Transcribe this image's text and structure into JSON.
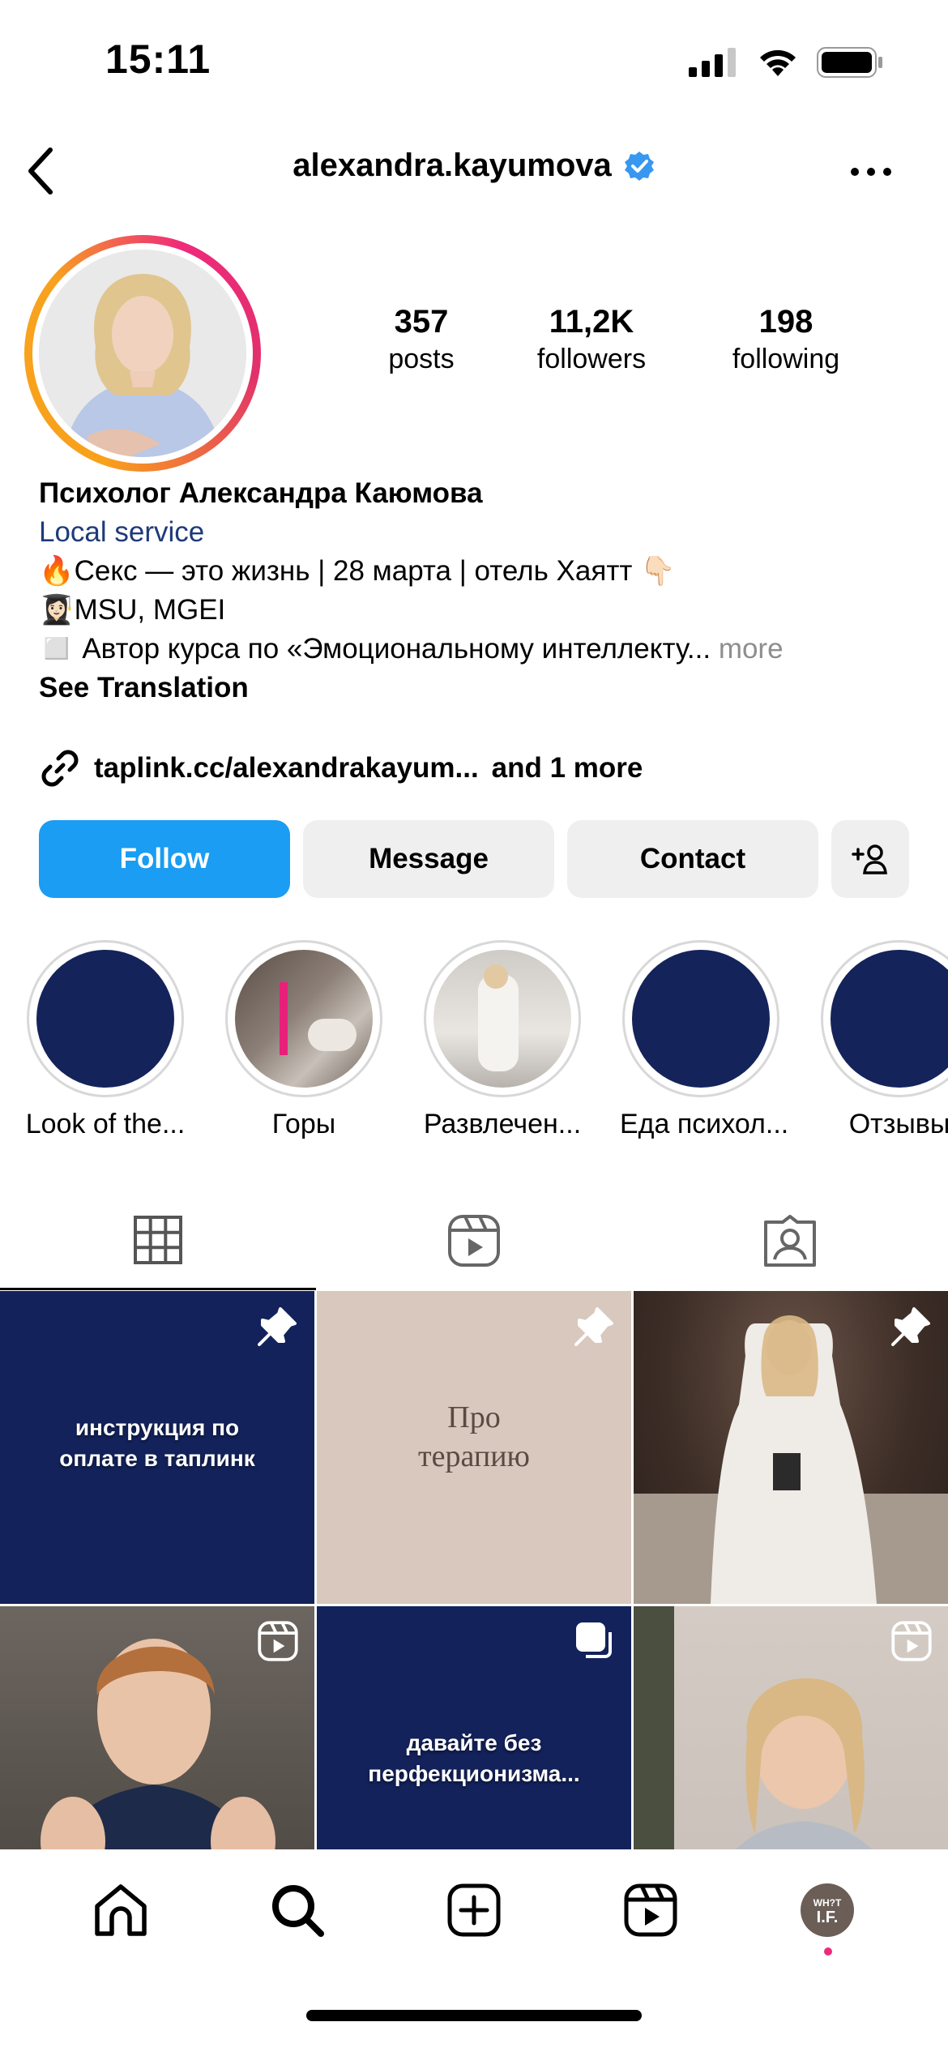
{
  "status_bar": {
    "time": "15:11"
  },
  "header": {
    "username": "alexandra.kayumova"
  },
  "stats": [
    {
      "value": "357",
      "label": "posts"
    },
    {
      "value": "11,2K",
      "label": "followers"
    },
    {
      "value": "198",
      "label": "following"
    }
  ],
  "bio": {
    "name": "Психолог Александра Каюмова",
    "category": "Local service",
    "line1_emoji": "🔥",
    "line1_text": "Секс — это жизнь | 28 марта | отель Хаятт",
    "line1_end_emoji": "👇🏻",
    "line2_emoji": "👩🏻‍🎓",
    "line2_text": "MSU, MGEI",
    "line3_emoji": "◻️",
    "line3_text": "Автор курса по «Эмоциональному интеллекту...",
    "more": "more",
    "see_translation": "See Translation"
  },
  "link": {
    "url": "taplink.cc/alexandrakayum...",
    "extra": "and 1 more"
  },
  "buttons": {
    "follow": "Follow",
    "message": "Message",
    "contact": "Contact"
  },
  "highlights": [
    {
      "label": "Look of the..."
    },
    {
      "label": "Горы"
    },
    {
      "label": "Развлечен..."
    },
    {
      "label": "Еда психол..."
    },
    {
      "label": "Отзывы"
    }
  ],
  "tabs": [
    {
      "icon": "grid-icon",
      "active": true
    },
    {
      "icon": "reels-icon",
      "active": false
    },
    {
      "icon": "tagged-icon",
      "active": false
    }
  ],
  "posts": [
    {
      "text": "инструкция по\nоплате в таплинк",
      "badge": "pin-icon",
      "bg": "#13225b"
    },
    {
      "text": "Про\nтерапию",
      "badge": "pin-icon",
      "bg": "#d8c8bd"
    },
    {
      "text": "",
      "badge": "pin-icon",
      "bg": "#4a3a32"
    },
    {
      "text": "",
      "badge": "reels-icon",
      "bg": "#5a5550"
    },
    {
      "text": "давайте без\nперфекционизма...",
      "badge": "carousel-icon",
      "bg": "#13225b"
    },
    {
      "text": "",
      "badge": "reels-icon",
      "bg": "#cfc7bf"
    }
  ],
  "bottom_nav": {
    "avatar_text_top": "WH?T",
    "avatar_text_bottom": "I.F."
  },
  "colors": {
    "follow_blue": "#1a9df3",
    "navy": "#13225b",
    "accent_pink": "#ee2a7b"
  }
}
